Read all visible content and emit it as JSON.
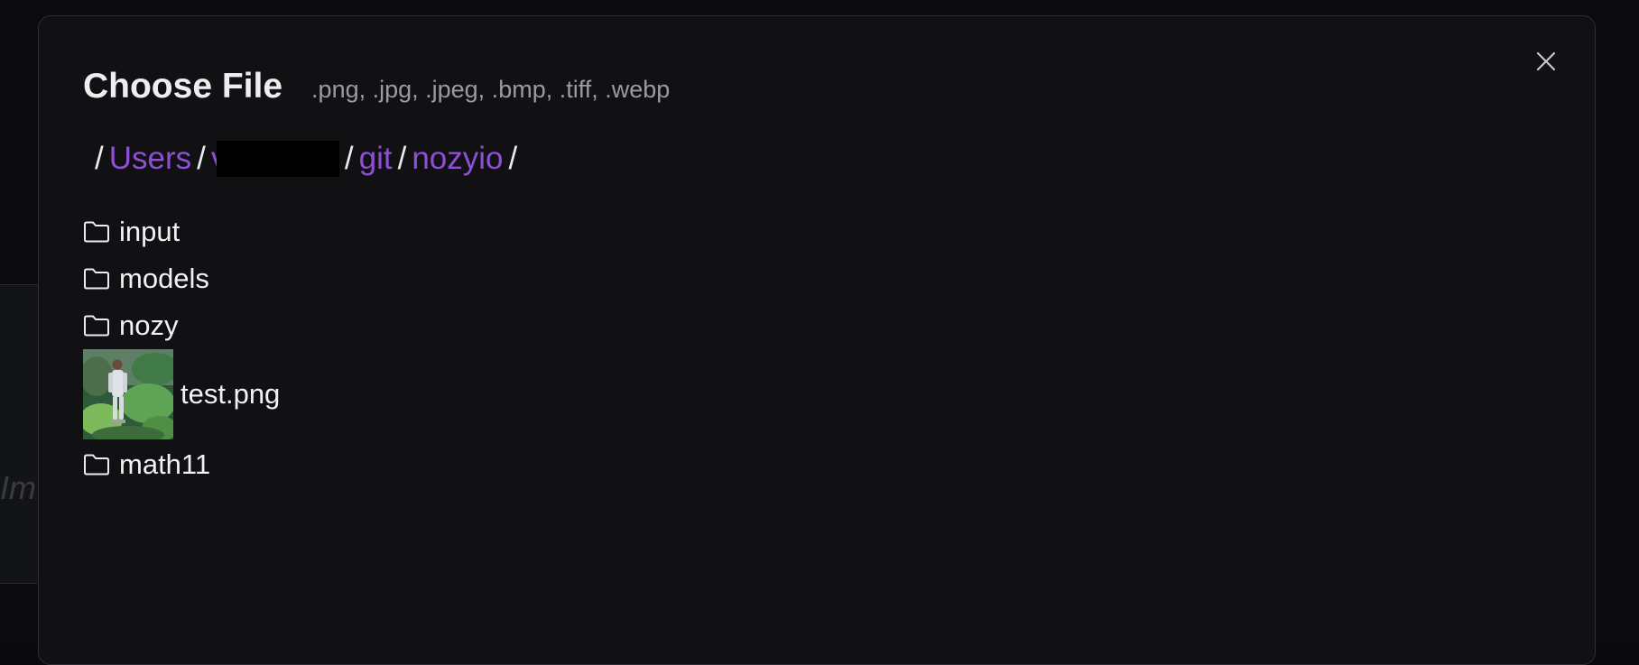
{
  "dialog": {
    "title": "Choose File",
    "accepted_types": ".png, .jpg, .jpeg, .bmp, .tiff, .webp",
    "close_icon": "close-icon"
  },
  "breadcrumb": {
    "root_separator": "/",
    "segments": [
      {
        "label": "Users"
      },
      {
        "label": "v",
        "redacted": true
      },
      {
        "label": "git"
      },
      {
        "label": "nozyio"
      }
    ],
    "separator": "/"
  },
  "entries": [
    {
      "name": "input",
      "type": "folder",
      "icon": "folder-icon"
    },
    {
      "name": "models",
      "type": "folder",
      "icon": "folder-icon"
    },
    {
      "name": "nozy",
      "type": "folder",
      "icon": "folder-icon"
    },
    {
      "name": "test.png",
      "type": "image",
      "icon": "image-thumbnail"
    },
    {
      "name": "math11",
      "type": "folder",
      "icon": "folder-icon"
    }
  ],
  "background": {
    "partial_text": "Im"
  },
  "colors": {
    "accent": "#8e4fd4",
    "modal_bg": "#111114",
    "text": "#f2f2f4",
    "muted": "#9a9aa2"
  }
}
